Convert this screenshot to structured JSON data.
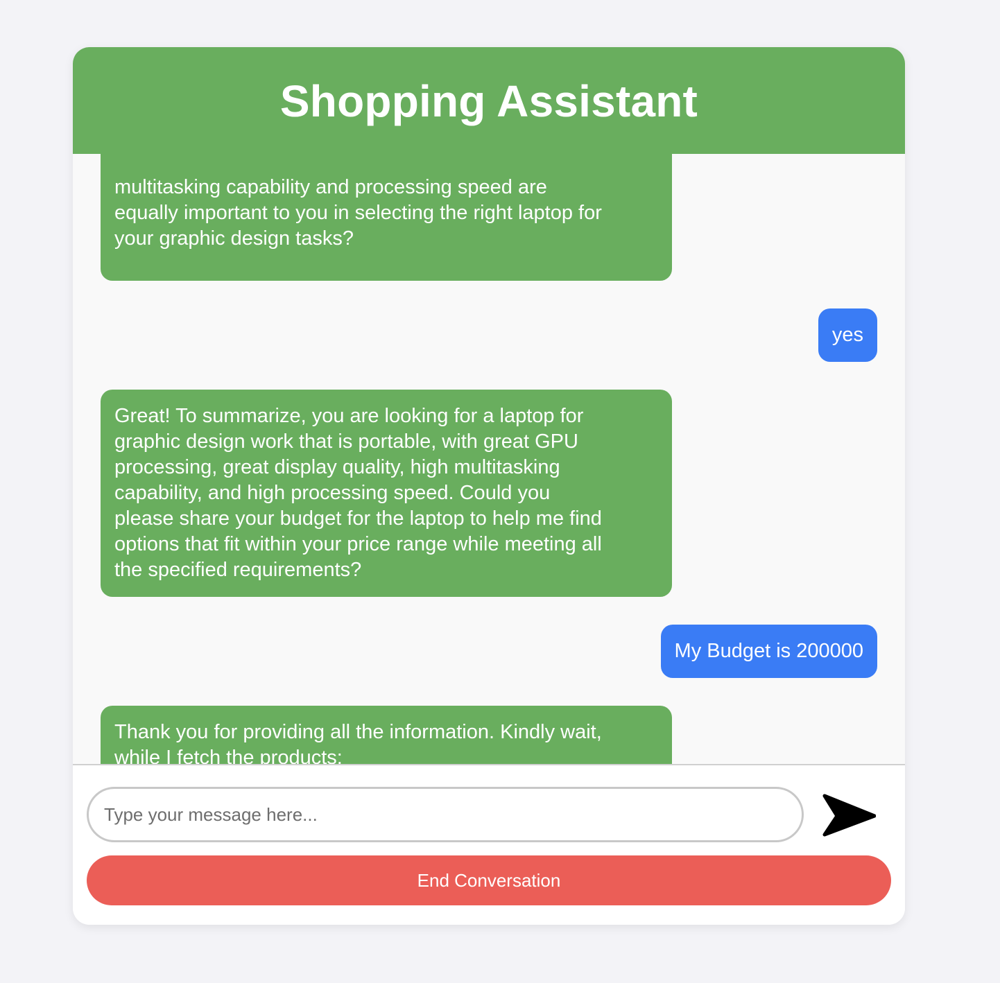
{
  "header": {
    "title": "Shopping Assistant"
  },
  "messages": [
    {
      "role": "assistant",
      "text": "multitasking capability and processing speed are\nequally important to you in selecting the right laptop for\nyour graphic design tasks?"
    },
    {
      "role": "user",
      "text": "yes"
    },
    {
      "role": "assistant",
      "text": "Great! To summarize, you are looking for a laptop for\ngraphic design work that is portable, with great GPU\nprocessing, great display quality, high multitasking\ncapability, and high processing speed. Could you\nplease share your budget for the laptop to help me find\noptions that fit within your price range while meeting all\nthe specified requirements?"
    },
    {
      "role": "user",
      "text": "My Budget is 200000"
    },
    {
      "role": "assistant",
      "text": "Thank you for providing all the information. Kindly wait,\nwhile I fetch the products:"
    }
  ],
  "input": {
    "placeholder": "Type your message here...",
    "value": ""
  },
  "send": {
    "icon": "send-icon"
  },
  "end_conversation": {
    "label": "End Conversation"
  },
  "colors": {
    "header": "#69ae5e",
    "assistant_bubble": "#69ae5e",
    "user_bubble": "#3a7cf5",
    "end_button": "#eb5e57"
  }
}
